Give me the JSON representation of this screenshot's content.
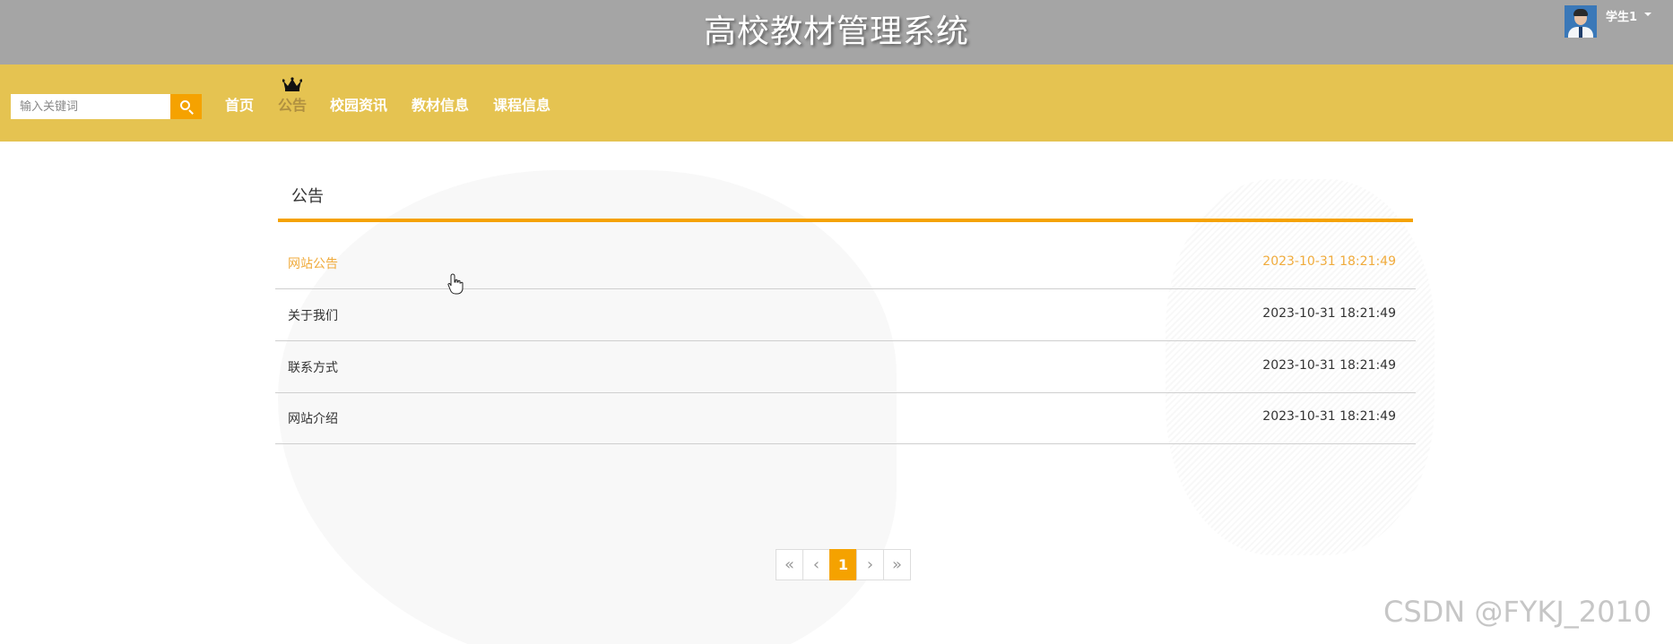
{
  "header": {
    "title": "高校教材管理系统",
    "user_name": "学生1"
  },
  "search": {
    "placeholder": "输入关键词"
  },
  "nav": {
    "items": [
      {
        "label": "首页"
      },
      {
        "label": "公告"
      },
      {
        "label": "校园资讯"
      },
      {
        "label": "教材信息"
      },
      {
        "label": "课程信息"
      }
    ],
    "active_index": 1
  },
  "section": {
    "title": "公告"
  },
  "notices": [
    {
      "title": "网站公告",
      "date": "2023-10-31 18:21:49"
    },
    {
      "title": "关于我们",
      "date": "2023-10-31 18:21:49"
    },
    {
      "title": "联系方式",
      "date": "2023-10-31 18:21:49"
    },
    {
      "title": "网站介绍",
      "date": "2023-10-31 18:21:49"
    }
  ],
  "pagination": {
    "first": "«",
    "prev": "‹",
    "current": "1",
    "next": "›",
    "last": "»"
  },
  "watermark": "CSDN @FYKJ_2010",
  "colors": {
    "header_bg": "#a5a5a5",
    "nav_bg": "#e5c351",
    "accent": "#f5a200",
    "hover_text": "#f0ab3c"
  }
}
